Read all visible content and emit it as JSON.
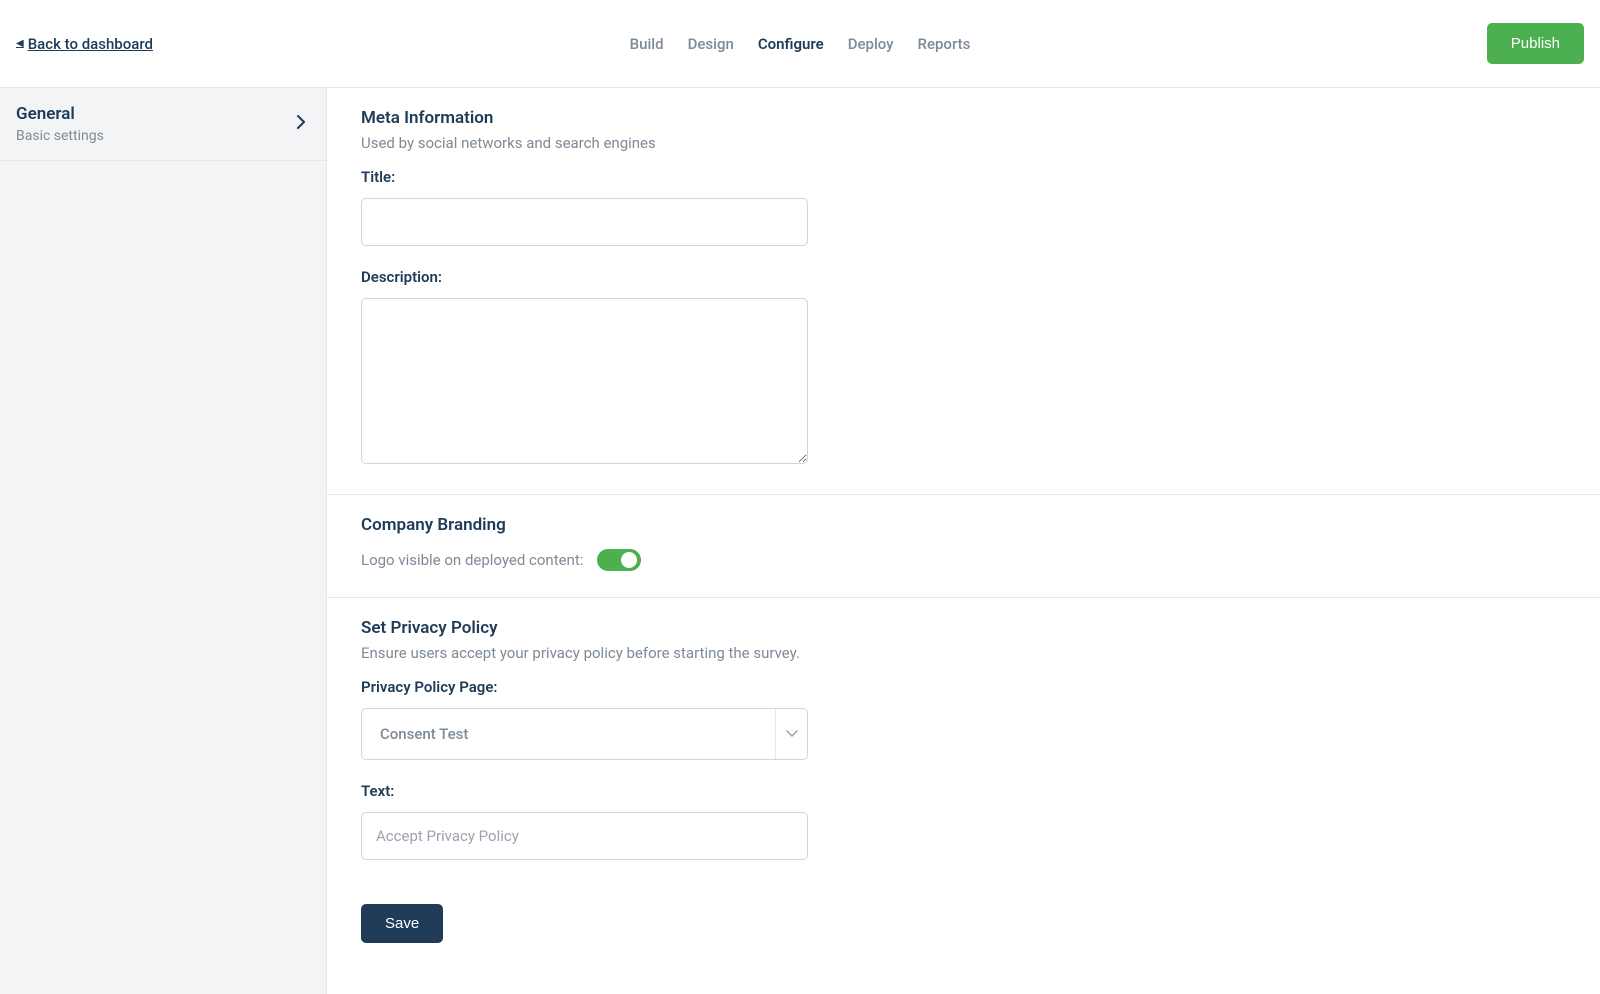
{
  "header": {
    "back_label": "Back to dashboard",
    "nav": [
      {
        "label": "Build",
        "active": false
      },
      {
        "label": "Design",
        "active": false
      },
      {
        "label": "Configure",
        "active": true
      },
      {
        "label": "Deploy",
        "active": false
      },
      {
        "label": "Reports",
        "active": false
      }
    ],
    "publish_label": "Publish"
  },
  "sidebar": {
    "items": [
      {
        "title": "General",
        "subtitle": "Basic settings"
      }
    ]
  },
  "sections": {
    "meta": {
      "title": "Meta Information",
      "subtitle": "Used by social networks and search engines",
      "title_label": "Title:",
      "title_value": "",
      "description_label": "Description:",
      "description_value": ""
    },
    "branding": {
      "title": "Company Branding",
      "logo_label": "Logo visible on deployed content:",
      "logo_toggle_on": true
    },
    "privacy": {
      "title": "Set Privacy Policy",
      "subtitle": "Ensure users accept your privacy policy before starting the survey.",
      "page_label": "Privacy Policy Page:",
      "page_value": "Consent Test",
      "text_label": "Text:",
      "text_value": "",
      "text_placeholder": "Accept Privacy Policy"
    }
  },
  "save_label": "Save"
}
